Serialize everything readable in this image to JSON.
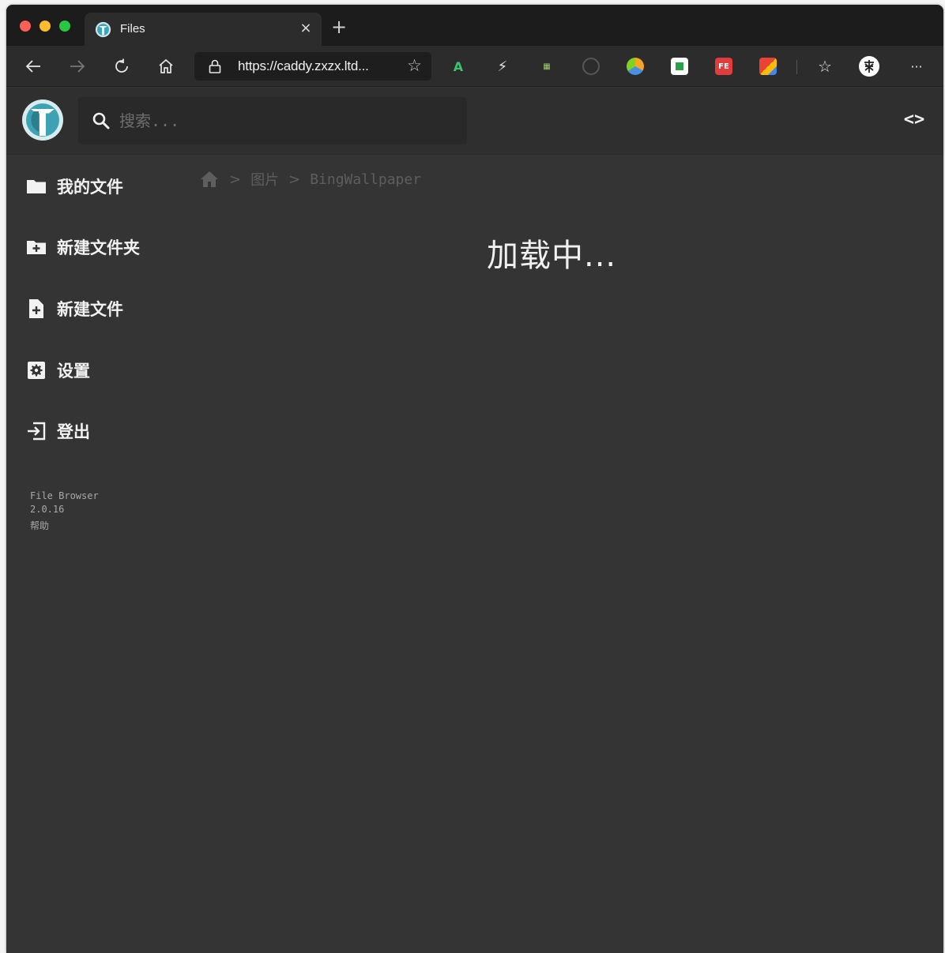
{
  "browser": {
    "tab": {
      "title": "Files",
      "close_glyph": "×"
    },
    "new_tab_glyph": "+",
    "address": {
      "url": "https://caddy.zxzx.ltd..."
    },
    "icons": [
      "back-icon",
      "forward-icon",
      "refresh-icon",
      "home-icon",
      "lock-icon",
      "favorite-star-icon",
      "read-aloud-extension-icon",
      "flash-extension-icon",
      "translate-extension-icon",
      "vpn-extension-icon",
      "color-extension-icon",
      "note-extension-icon",
      "fe-helper-extension-icon",
      "google-translate-extension-icon",
      "favorites-list-icon",
      "profile-icon",
      "more-icon"
    ],
    "more_glyph": "···"
  },
  "app": {
    "search": {
      "placeholder": "搜索..."
    },
    "code_toggle_glyph": "<>",
    "sidebar": {
      "items": [
        {
          "label": "我的文件",
          "icon": "folder-icon"
        },
        {
          "label": "新建文件夹",
          "icon": "new-folder-icon"
        },
        {
          "label": "新建文件",
          "icon": "new-file-icon"
        },
        {
          "label": "设置",
          "icon": "settings-icon"
        },
        {
          "label": "登出",
          "icon": "logout-icon"
        }
      ],
      "footer": {
        "app_name": "File Browser",
        "version": "2.0.16",
        "help": "帮助"
      }
    },
    "breadcrumb": {
      "items": [
        "图片",
        "BingWallpaper"
      ],
      "separator": ">"
    },
    "loading_text": "加载中..."
  }
}
